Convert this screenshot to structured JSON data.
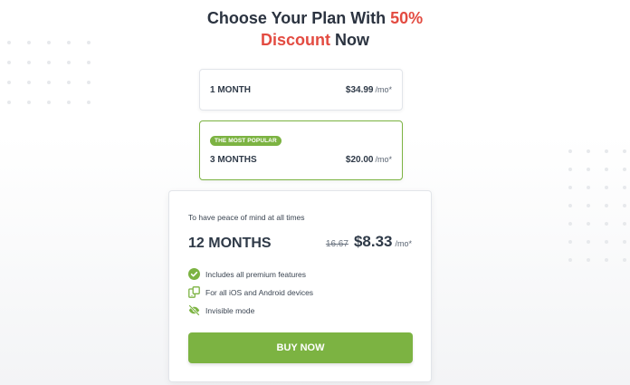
{
  "heading": {
    "line1_text": "Choose Your Plan With ",
    "line1_highlight": "50%",
    "line2_highlight": "Discount",
    "line2_text": " Now"
  },
  "plans": [
    {
      "name": "1 MONTH",
      "price": "$34.99",
      "unit": "/mo*"
    },
    {
      "badge": "THE MOST POPULAR",
      "name": "3 MONTHS",
      "price": "$20.00",
      "unit": "/mo*"
    }
  ],
  "featured": {
    "tagline": "To have peace of mind at all times",
    "name": "12 MONTHS",
    "old_price": "16.67",
    "price": "$8.33",
    "unit": "/mo*",
    "features": [
      {
        "icon": "check-circle-icon",
        "label": "Includes all premium features"
      },
      {
        "icon": "devices-icon",
        "label": "For all iOS and Android devices"
      },
      {
        "icon": "eye-off-icon",
        "label": "Invisible mode"
      }
    ],
    "button_label": "BUY NOW"
  },
  "colors": {
    "accent_green": "#7cb342",
    "highlight_red": "#e34b41",
    "text_dark": "#2f3a48"
  }
}
